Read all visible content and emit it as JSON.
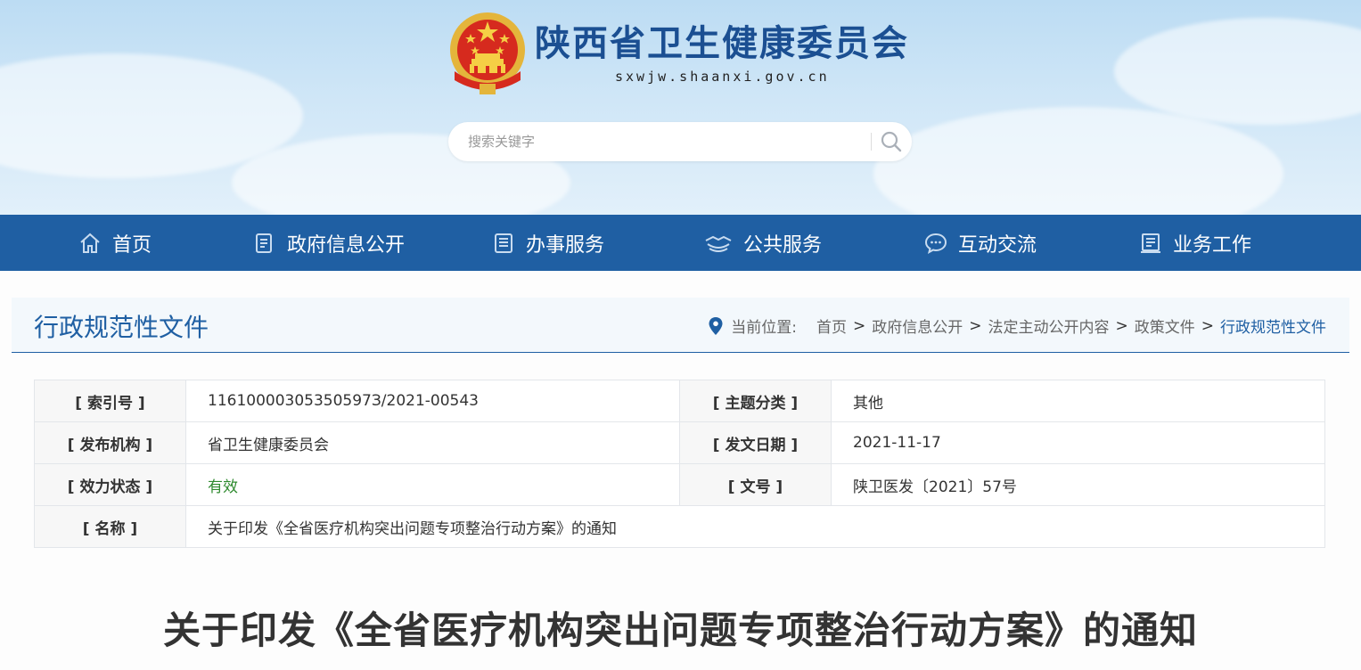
{
  "header": {
    "site_title": "陕西省卫生健康委员会",
    "site_url": "sxwjw.shaanxi.gov.cn",
    "search": {
      "placeholder": "搜索关键字",
      "icon": "search-icon"
    }
  },
  "nav": {
    "items": [
      {
        "label": "首页",
        "icon": "home-icon"
      },
      {
        "label": "政府信息公开",
        "icon": "document-icon"
      },
      {
        "label": "办事服务",
        "icon": "list-icon"
      },
      {
        "label": "公共服务",
        "icon": "handshake-icon"
      },
      {
        "label": "互动交流",
        "icon": "chat-icon"
      },
      {
        "label": "业务工作",
        "icon": "book-icon"
      }
    ]
  },
  "section": {
    "title": "行政规范性文件",
    "location_label": "当前位置:",
    "breadcrumb": [
      "首页",
      "政府信息公开",
      "法定主动公开内容",
      "政策文件",
      "行政规范性文件"
    ],
    "separator": ">"
  },
  "meta": {
    "index_no_label": "[ 索引号 ]",
    "index_no": "11610000305350597З/2021-00543",
    "topic_label": "[ 主题分类 ]",
    "topic": "其他",
    "publisher_label": "[ 发布机构 ]",
    "publisher": "省卫生健康委员会",
    "date_label": "[ 发文日期 ]",
    "date": "2021-11-17",
    "status_label": "[ 效力状态 ]",
    "status": "有效",
    "doc_no_label": "[ 文号 ]",
    "doc_no": "陕卫医发〔2021〕57号",
    "name_label": "[ 名称 ]",
    "name": "关于印发《全省医疗机构突出问题专项整治行动方案》的通知"
  },
  "article": {
    "title": "关于印发《全省医疗机构突出问题专项整治行动方案》的通知"
  },
  "colors": {
    "brand_blue": "#1f5fa3",
    "status_green": "#2f8a2f"
  }
}
